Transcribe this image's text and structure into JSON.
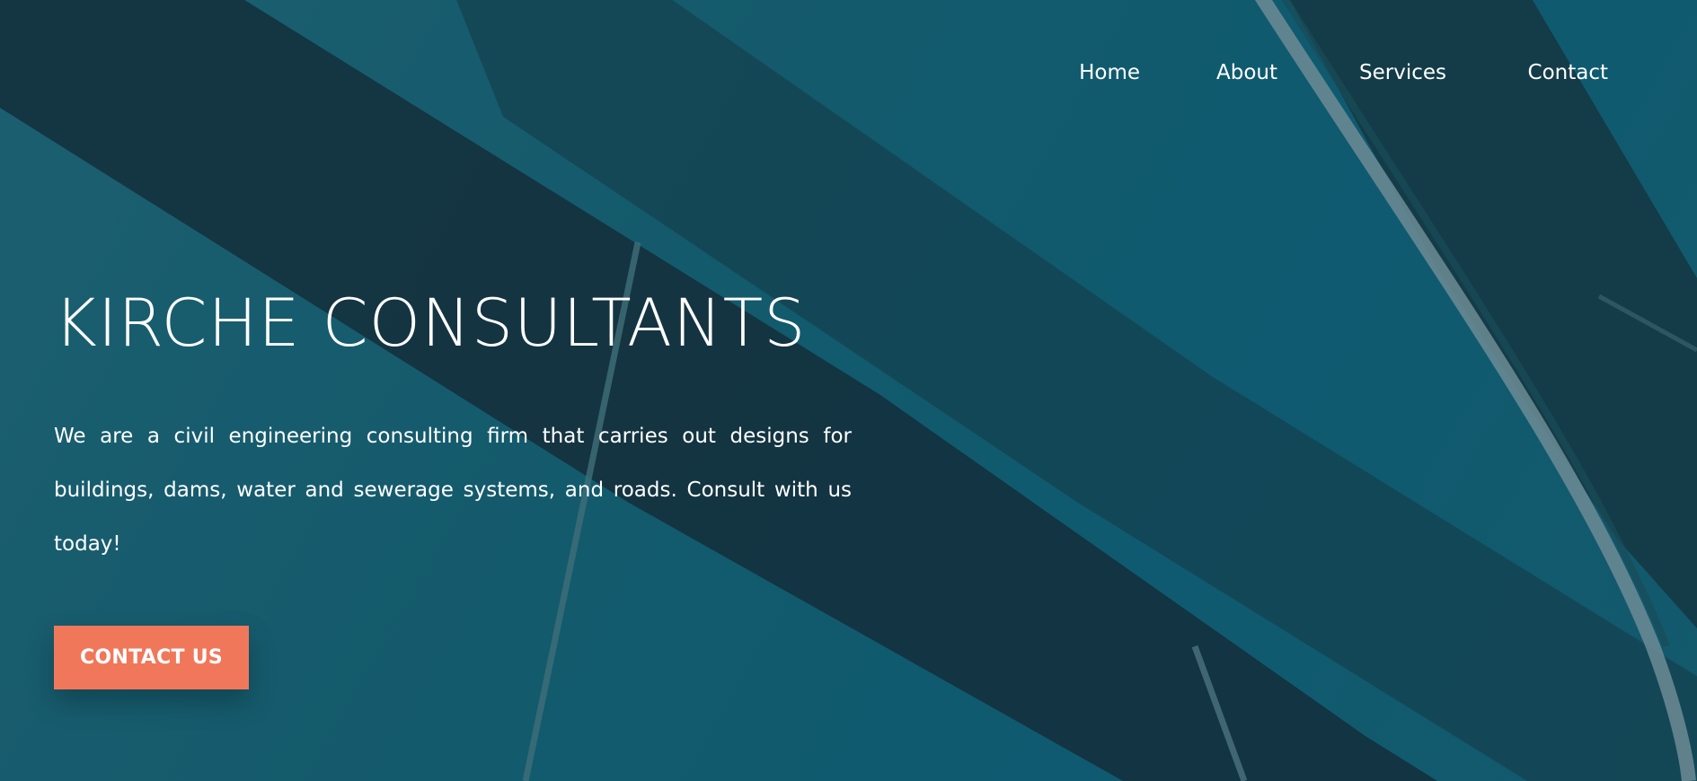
{
  "nav": {
    "items": [
      {
        "label": "Home"
      },
      {
        "label": "About"
      },
      {
        "label": "Services"
      },
      {
        "label": "Contact"
      }
    ]
  },
  "hero": {
    "title": "KIRCHE CONSULTANTS",
    "description": "We are a civil engineering consulting firm that carries out designs for buildings, dams, water and sewerage systems, and roads. Consult with us today!",
    "cta_label": "CONTACT US"
  },
  "colors": {
    "background": "#135a6c",
    "beam_dark": "#14333f",
    "cta": "#f1775a",
    "text": "#ffffff"
  }
}
